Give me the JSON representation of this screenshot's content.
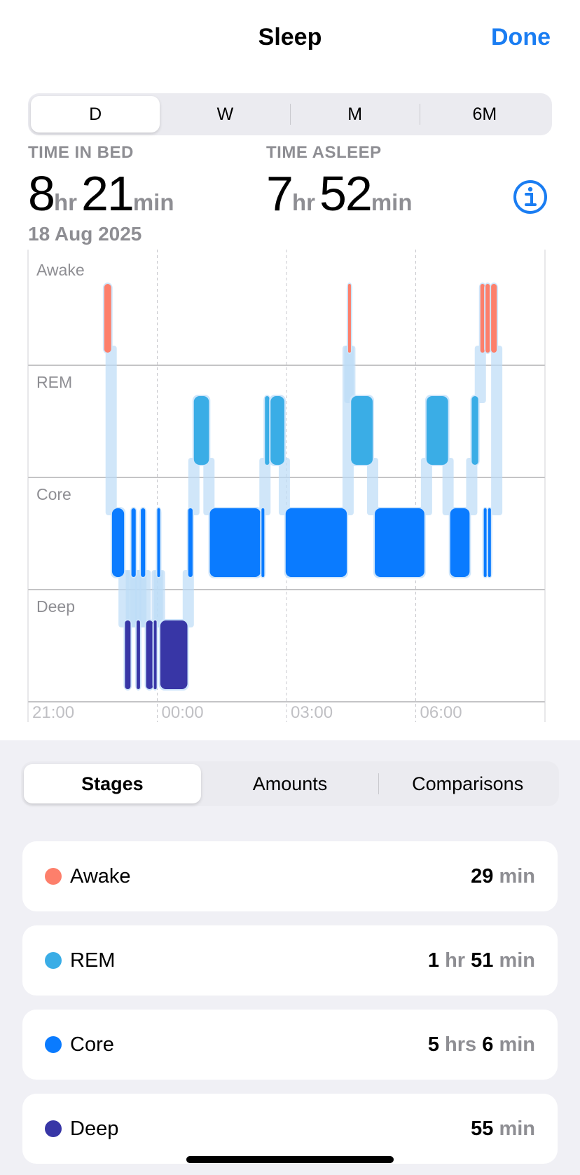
{
  "nav": {
    "title": "Sleep",
    "done_label": "Done"
  },
  "range_tabs": [
    {
      "label": "D",
      "selected": true
    },
    {
      "label": "W",
      "selected": false
    },
    {
      "label": "M",
      "selected": false
    },
    {
      "label": "6M",
      "selected": false
    }
  ],
  "summary": {
    "time_in_bed_label": "TIME IN BED",
    "time_in_bed_hr": "8",
    "time_in_bed_min": "21",
    "time_asleep_label": "TIME ASLEEP",
    "time_asleep_hr": "7",
    "time_asleep_min": "52",
    "hr_unit": "hr",
    "min_unit": "min",
    "date": "18 Aug 2025"
  },
  "colors": {
    "awake": "#fd7f6b",
    "rem": "#3aade6",
    "core": "#0a7bff",
    "deep": "#3836a6",
    "accent": "#1a7df2"
  },
  "chart_data": {
    "type": "sleep-stages",
    "stages": [
      "Awake",
      "REM",
      "Core",
      "Deep"
    ],
    "x_ticks": [
      "21:00",
      "00:00",
      "03:00",
      "06:00"
    ],
    "x_start_hour": 21,
    "x_end_hour": 33,
    "segments": [
      {
        "stage": "Awake",
        "start": 22.77,
        "end": 22.93
      },
      {
        "stage": "Core",
        "start": 22.95,
        "end": 23.23
      },
      {
        "stage": "Deep",
        "start": 23.25,
        "end": 23.38
      },
      {
        "stage": "Core",
        "start": 23.4,
        "end": 23.5
      },
      {
        "stage": "Deep",
        "start": 23.52,
        "end": 23.6
      },
      {
        "stage": "Core",
        "start": 23.62,
        "end": 23.72
      },
      {
        "stage": "Deep",
        "start": 23.74,
        "end": 23.9
      },
      {
        "stage": "Deep",
        "start": 23.92,
        "end": 23.98
      },
      {
        "stage": "Core",
        "start": 24.0,
        "end": 24.05
      },
      {
        "stage": "Deep",
        "start": 24.07,
        "end": 24.7
      },
      {
        "stage": "Core",
        "start": 24.72,
        "end": 24.82
      },
      {
        "stage": "REM",
        "start": 24.85,
        "end": 25.2
      },
      {
        "stage": "Core",
        "start": 25.22,
        "end": 26.4
      },
      {
        "stage": "Core",
        "start": 26.42,
        "end": 26.48
      },
      {
        "stage": "REM",
        "start": 26.5,
        "end": 26.6
      },
      {
        "stage": "REM",
        "start": 26.63,
        "end": 26.95
      },
      {
        "stage": "Core",
        "start": 26.98,
        "end": 28.4
      },
      {
        "stage": "Awake",
        "start": 28.43,
        "end": 28.47
      },
      {
        "stage": "REM",
        "start": 28.5,
        "end": 29.0
      },
      {
        "stage": "Core",
        "start": 29.05,
        "end": 30.2
      },
      {
        "stage": "REM",
        "start": 30.25,
        "end": 30.75
      },
      {
        "stage": "Core",
        "start": 30.8,
        "end": 31.25
      },
      {
        "stage": "REM",
        "start": 31.3,
        "end": 31.45
      },
      {
        "stage": "Awake",
        "start": 31.5,
        "end": 31.6
      },
      {
        "stage": "Awake",
        "start": 31.62,
        "end": 31.72
      },
      {
        "stage": "Awake",
        "start": 31.75,
        "end": 31.88
      },
      {
        "stage": "Core",
        "start": 31.58,
        "end": 31.64
      },
      {
        "stage": "Core",
        "start": 31.68,
        "end": 31.74
      }
    ]
  },
  "detail_tabs": [
    {
      "label": "Stages",
      "selected": true
    },
    {
      "label": "Amounts",
      "selected": false
    },
    {
      "label": "Comparisons",
      "selected": false
    }
  ],
  "stage_totals": [
    {
      "name": "Awake",
      "color": "#fd7f6b",
      "parts": [
        {
          "n": "29",
          "u": "min"
        }
      ]
    },
    {
      "name": "REM",
      "color": "#3aade6",
      "parts": [
        {
          "n": "1",
          "u": "hr"
        },
        {
          "n": "51",
          "u": "min"
        }
      ]
    },
    {
      "name": "Core",
      "color": "#0a7bff",
      "parts": [
        {
          "n": "5",
          "u": "hrs"
        },
        {
          "n": "6",
          "u": "min"
        }
      ]
    },
    {
      "name": "Deep",
      "color": "#3836a6",
      "parts": [
        {
          "n": "55",
          "u": "min"
        }
      ]
    }
  ]
}
